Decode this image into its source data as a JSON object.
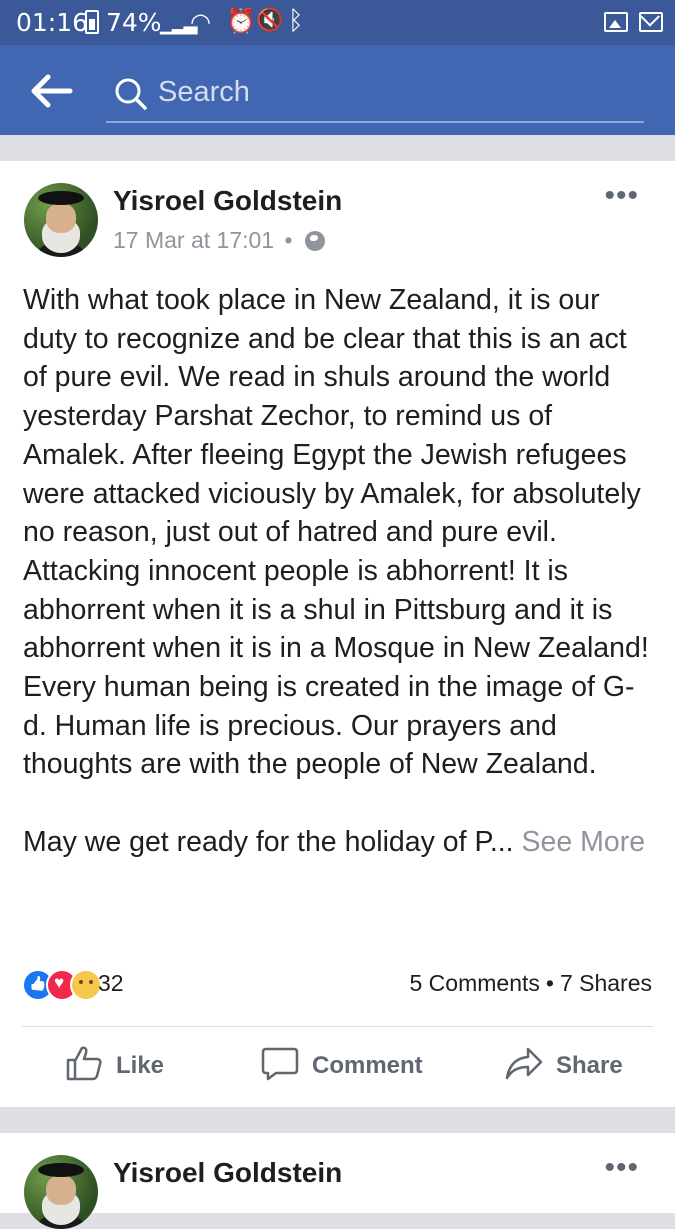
{
  "status_bar": {
    "time": "01:16",
    "battery": "74%",
    "icons": [
      "battery-icon",
      "signal-icon",
      "wifi-icon",
      "alarm-icon",
      "mute-icon",
      "bluetooth-icon",
      "gallery-icon",
      "mail-icon"
    ]
  },
  "header": {
    "search_placeholder": "Search",
    "back_icon": "back-arrow-icon",
    "search_icon": "search-icon",
    "color": "#4267b2"
  },
  "post": {
    "author": "Yisroel Goldstein",
    "timestamp": "17 Mar at 17:01",
    "separator": "•",
    "audience_icon": "globe-icon",
    "more_icon": "more-options-icon",
    "body_paragraph_1": "With what took place in New Zealand, it is our duty to recognize and be clear that this is an act of pure evil. We read in shuls around the world yesterday Parshat Zechor, to remind us of Amalek. After fleeing Egypt the Jewish refugees were attacked viciously by Amalek, for absolutely no reason, just out of hatred and pure evil. Attacking innocent people is abhorrent! It is abhorrent when it is a shul in Pittsburg and it is abhorrent when it is in a Mosque in New Zealand! Every human being is created in the image of G-d. Human life is precious. Our prayers and thoughts are with the people of New Zealand.",
    "body_paragraph_2": "May we get ready for the holiday of P... ",
    "see_more": "See More",
    "reaction_icons": [
      "like-reaction-icon",
      "love-reaction-icon",
      "sad-reaction-icon"
    ],
    "reaction_count": "32",
    "comments": "5 Comments",
    "stats_separator": "•",
    "shares": "7 Shares",
    "actions": {
      "like": "Like",
      "comment": "Comment",
      "share": "Share"
    }
  },
  "next_post": {
    "author": "Yisroel Goldstein",
    "more_icon": "more-options-icon"
  }
}
